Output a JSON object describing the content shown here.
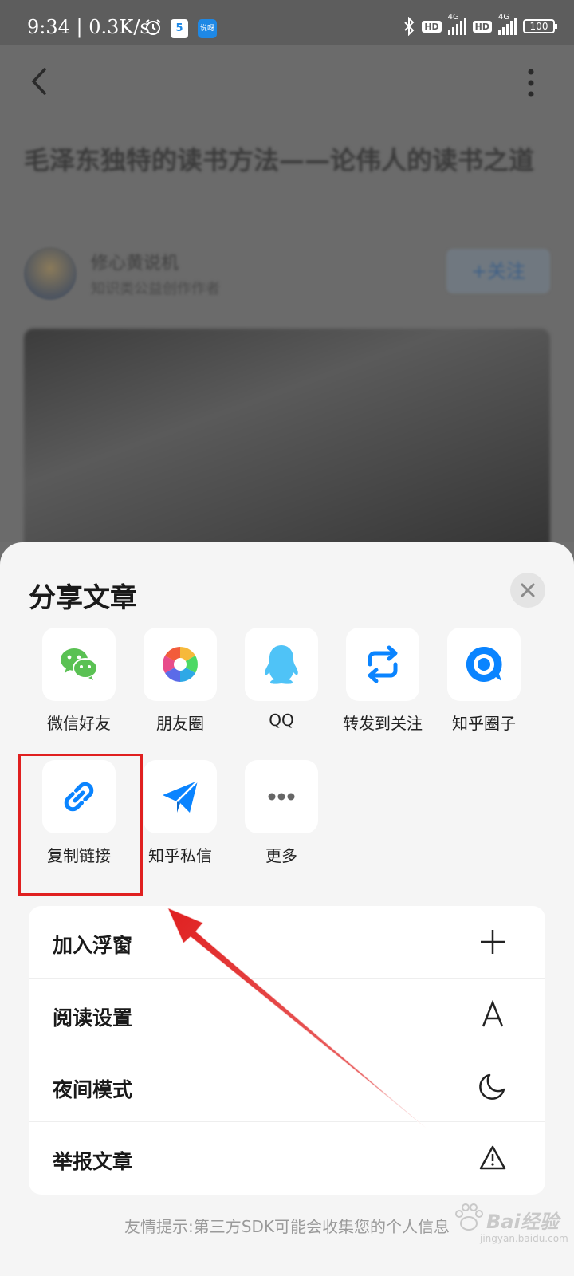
{
  "status_bar": {
    "time_speed": "9:34 | 0.3K/s",
    "app1_badge": "5",
    "app2_badge": "说呀",
    "hd1": "HD",
    "hd2": "HD",
    "net1": "4G",
    "net2": "4G",
    "battery": "100"
  },
  "article": {
    "title": "毛泽东独特的读书方法——论伟人的读书之道",
    "author_name": "修心黄说机",
    "author_desc": "知识类公益创作作者",
    "follow_label": "+关注"
  },
  "share_sheet": {
    "title": "分享文章",
    "targets": [
      {
        "label": "微信好友",
        "icon": "wechat-icon"
      },
      {
        "label": "朋友圈",
        "icon": "moments-icon"
      },
      {
        "label": "QQ",
        "icon": "qq-icon"
      },
      {
        "label": "转发到关注",
        "icon": "repost-icon"
      },
      {
        "label": "知乎圈子",
        "icon": "zhihu-circle-icon"
      },
      {
        "label": "复制链接",
        "icon": "link-icon"
      },
      {
        "label": "知乎私信",
        "icon": "paper-plane-icon"
      },
      {
        "label": "更多",
        "icon": "more-dots-icon"
      }
    ],
    "menu": [
      {
        "label": "加入浮窗",
        "icon": "plus-icon"
      },
      {
        "label": "阅读设置",
        "icon": "font-a-icon"
      },
      {
        "label": "夜间模式",
        "icon": "moon-icon"
      },
      {
        "label": "举报文章",
        "icon": "warning-icon"
      }
    ],
    "hint": "友情提示:第三方SDK可能会收集您的个人信息"
  },
  "annotation": {
    "highlight_color": "#e02020",
    "arrow_color": "#e02020"
  },
  "watermark": {
    "text": "Bai经验",
    "sub": "jingyan.baidu.com"
  },
  "colors": {
    "accent_blue": "#0a84ff",
    "wechat_green": "#5ac153",
    "qq_blue": "#4fc3f7"
  }
}
